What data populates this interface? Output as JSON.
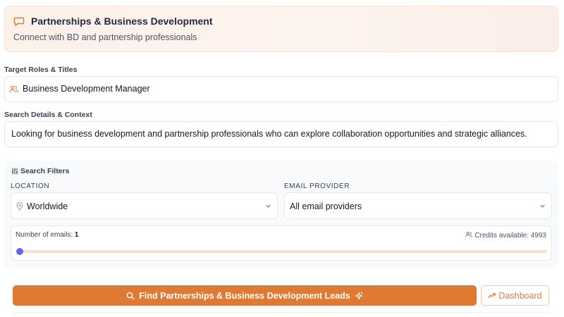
{
  "header": {
    "icon": "chat-bubble-icon",
    "title": "Partnerships & Business Development",
    "subtitle": "Connect with BD and partnership professionals"
  },
  "roles": {
    "label": "Target Roles & Titles",
    "icon": "users-icon",
    "value": "Business Development Manager"
  },
  "context": {
    "label": "Search Details & Context",
    "value": "Looking for business development and partnership professionals who can explore collaboration opportunities and strategic alliances."
  },
  "filters": {
    "title": "Search Filters",
    "icon": "sliders-icon",
    "location": {
      "label": "LOCATION",
      "value": "Worldwide",
      "icon": "map-pin-icon"
    },
    "email_provider": {
      "label": "EMAIL PROVIDER",
      "value": "All email providers"
    },
    "emails": {
      "label": "Number of emails:",
      "count": "1",
      "credits_label": "Credits available: 4993",
      "slider_fraction": 0
    }
  },
  "actions": {
    "find_label": "Find Partnerships & Business Development Leads",
    "dashboard_label": "Dashboard"
  },
  "colors": {
    "accent": "#e07a33",
    "slider_thumb": "#6366f1",
    "slider_track": "#f8dfc8"
  }
}
